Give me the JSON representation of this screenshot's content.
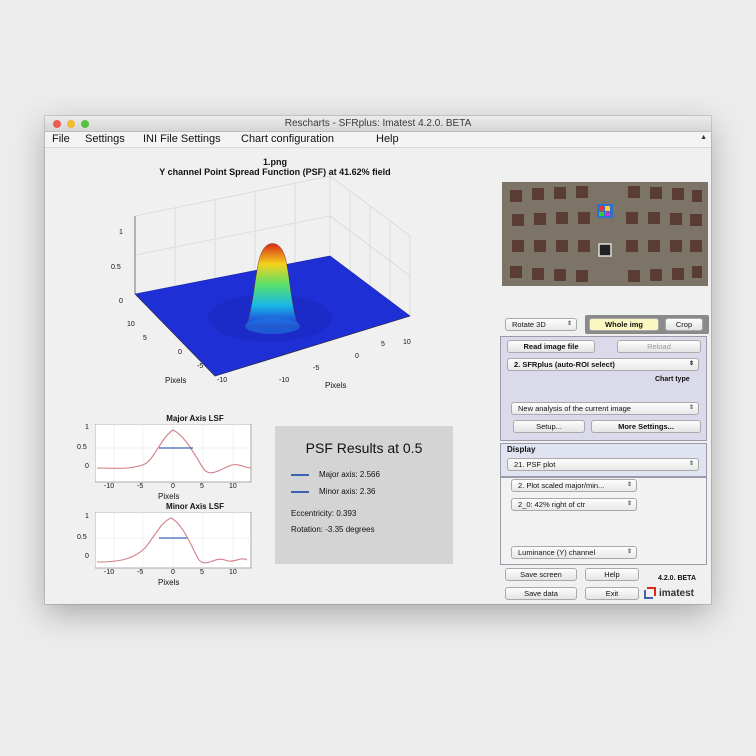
{
  "window": {
    "title": "Rescharts - SFRplus:  Imatest 4.2.0. BETA"
  },
  "menu": [
    "File",
    "Settings",
    "INI File Settings",
    "Chart configuration",
    "Help"
  ],
  "plot3d": {
    "title_line1": "1.png",
    "title_line2": "Y channel Point Spread Function (PSF) at 41.62% field",
    "z_ticks": [
      "1",
      "0.5",
      "0"
    ],
    "left_ticks": [
      "10",
      "5",
      "0",
      "-5",
      "-10"
    ],
    "right_ticks": [
      "-10",
      "-5",
      "0",
      "5",
      "10"
    ],
    "left_label": "Pixels",
    "right_label": "Pixels"
  },
  "lsf_major": {
    "title": "Major Axis LSF",
    "y_ticks": [
      "1",
      "0.5",
      "0"
    ],
    "x_ticks": [
      "-10",
      "-5",
      "0",
      "5",
      "10"
    ],
    "xlabel": "Pixels"
  },
  "lsf_minor": {
    "title": "Minor Axis LSF",
    "y_ticks": [
      "1",
      "0.5",
      "0"
    ],
    "x_ticks": [
      "-10",
      "-5",
      "0",
      "5",
      "10"
    ],
    "xlabel": "Pixels"
  },
  "psf_results": {
    "title": "PSF Results at 0.5",
    "major_axis": "Major axis: 2.566",
    "minor_axis": "Minor axis: 2.36",
    "eccentricity": "Eccentricity: 0.393",
    "rotation": "Rotation: -3.35 degrees"
  },
  "controls": {
    "rotate_select": "Rotate 3D",
    "whole_img": "Whole img",
    "crop": "Crop",
    "read_image": "Read image file",
    "reload": "Reload",
    "chart_select": "2.  SFRplus (auto-ROI select)",
    "chart_type_label": "Chart type",
    "analysis_select": "New analysis of the current image",
    "setup": "Setup...",
    "more_settings": "More Settings...",
    "display_label": "Display",
    "display_select": "21. PSF plot",
    "plot_select": "2. Plot scaled major/min...",
    "roi_select": "2_0: 42% right of ctr",
    "channel_select": "Luminance (Y) channel",
    "save_screen": "Save screen",
    "help": "Help",
    "save_data": "Save data",
    "exit": "Exit",
    "version": "4.2.0. BETA",
    "brand": "imatest"
  },
  "colors": {
    "accent_blue": "#3b63b0",
    "lsf_curve": "#d27f86",
    "psf_surface_low": "#1f2fd6",
    "psf_peak": "#d62a14"
  }
}
